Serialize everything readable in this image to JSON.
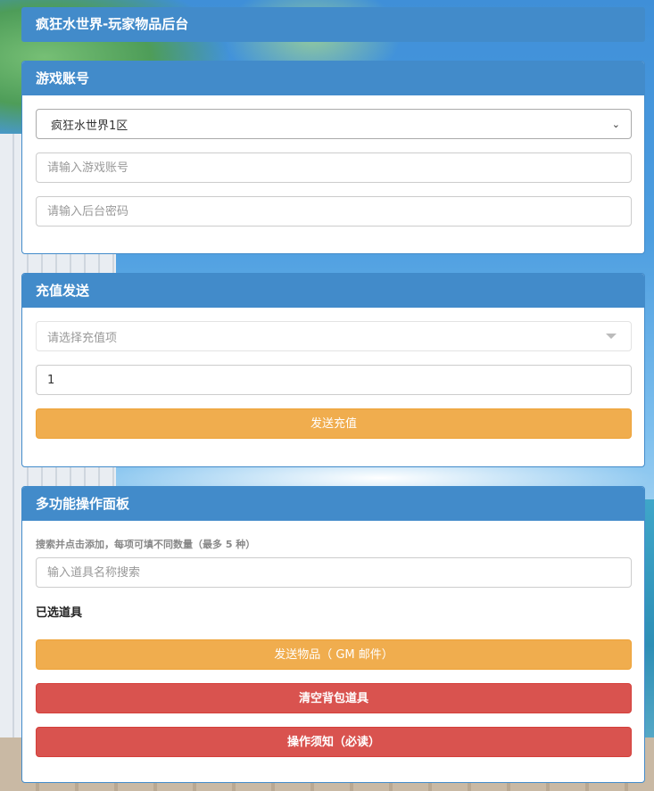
{
  "app": {
    "title": "疯狂水世界-玩家物品后台"
  },
  "account_panel": {
    "heading": "游戏账号",
    "server_select": {
      "value": "疯狂水世界1区"
    },
    "account_input": {
      "placeholder": "请输入游戏账号"
    },
    "password_input": {
      "placeholder": "请输入后台密码"
    }
  },
  "recharge_panel": {
    "heading": "充值发送",
    "item_select": {
      "placeholder": "请选择充值项"
    },
    "quantity_input": {
      "value": "1"
    },
    "send_button": "发送充值"
  },
  "multi_panel": {
    "heading": "多功能操作面板",
    "hint": "搜索并点击添加，每项可填不同数量（最多 5 种）",
    "search_input": {
      "placeholder": "输入道具名称搜索"
    },
    "selected_label": "已选道具",
    "send_items_button": "发送物品（ GM 邮件）",
    "clear_bag_button": "清空背包道具",
    "notice_button": "操作须知（必读）"
  },
  "colors": {
    "primary": "#428bca",
    "warning": "#f0ad4e",
    "danger": "#d9534f"
  }
}
